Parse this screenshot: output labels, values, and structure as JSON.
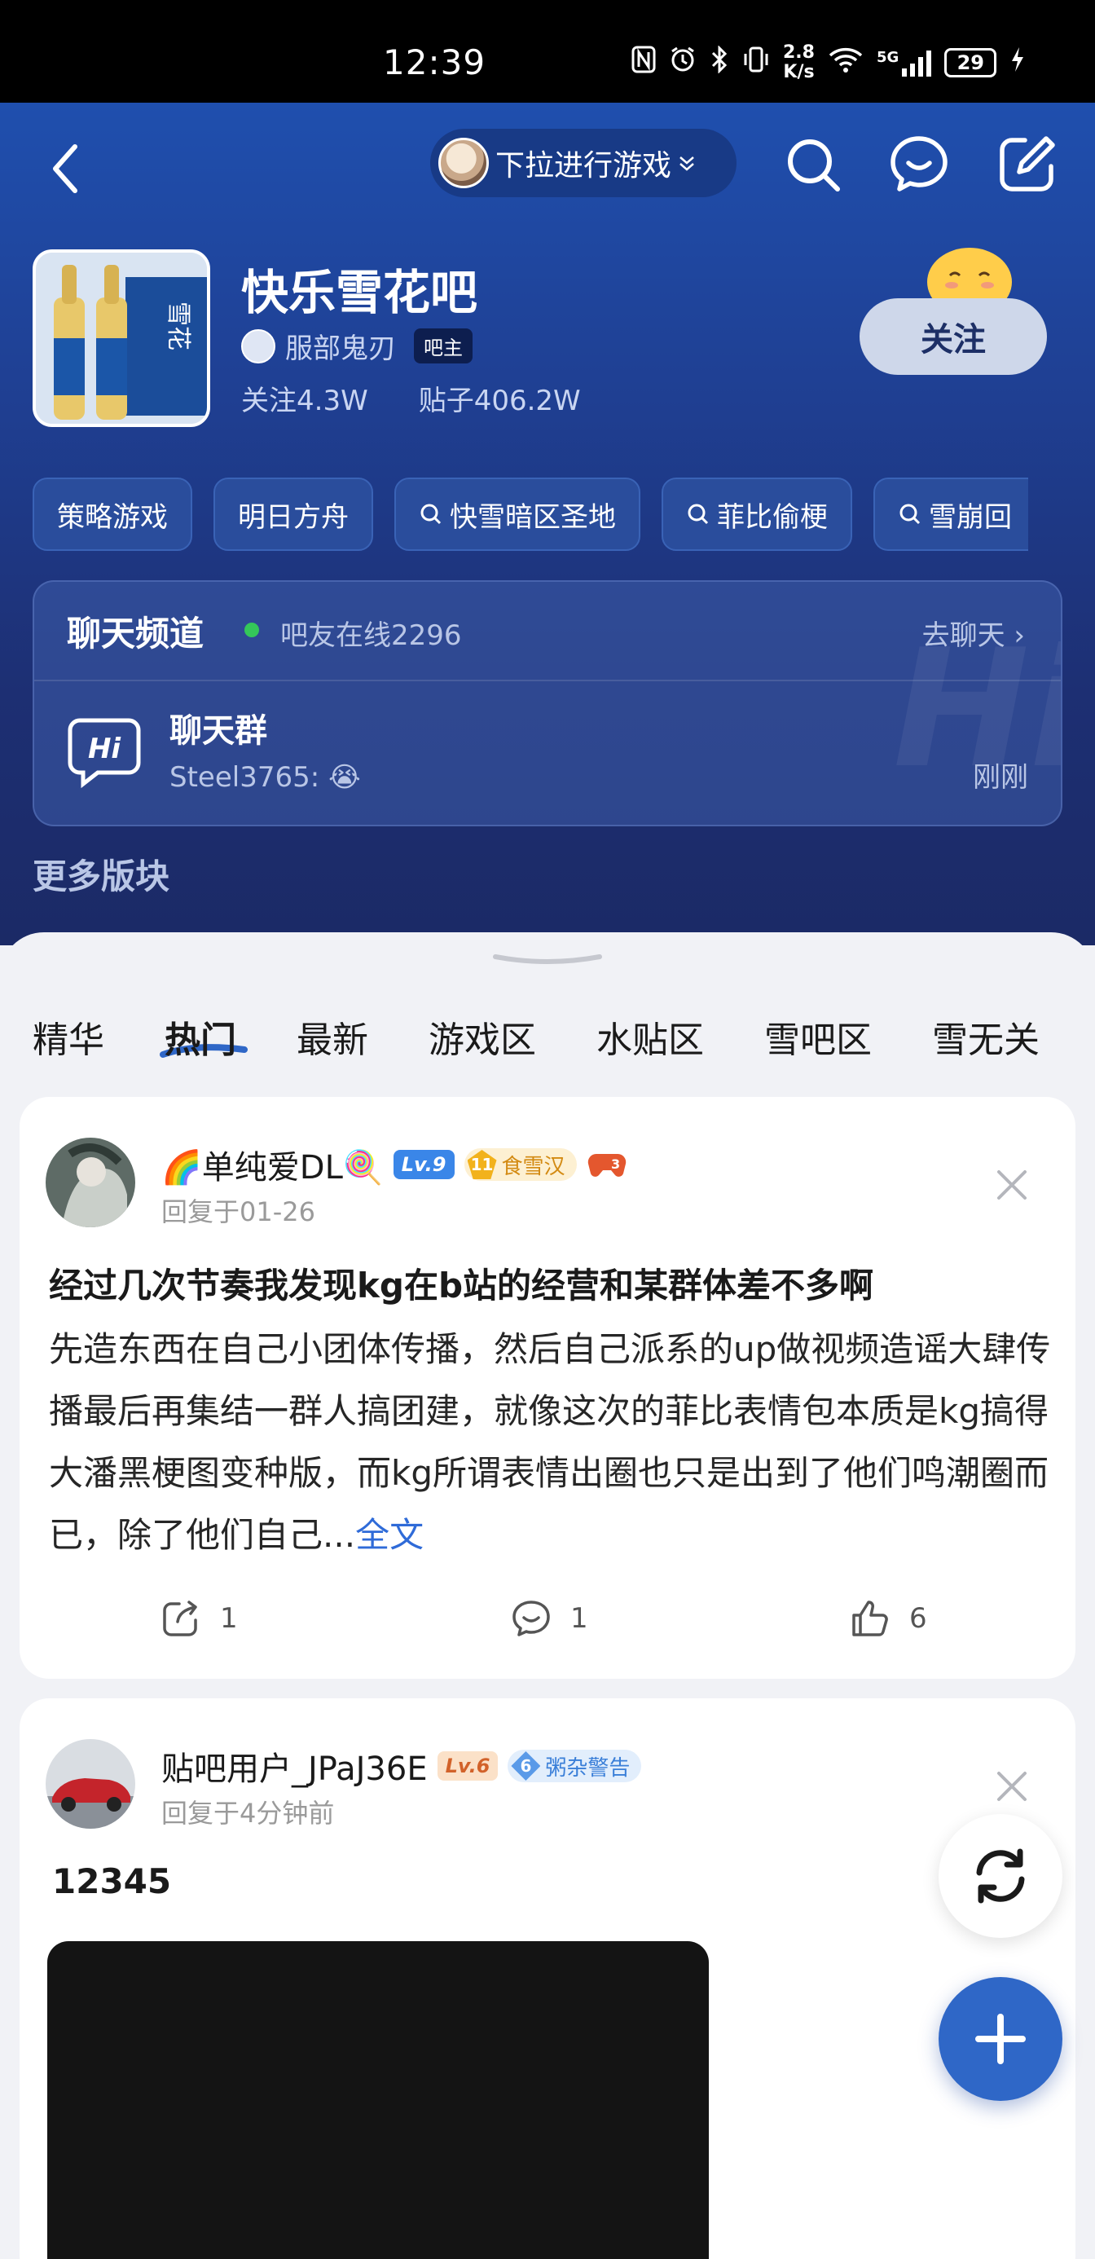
{
  "status_bar": {
    "time": "12:39",
    "net_speed_value": "2.8",
    "net_speed_unit": "K/s",
    "battery": "29",
    "network": "5G"
  },
  "header": {
    "game_pill_label": "下拉进行游戏",
    "forum_name": "快乐雪花吧",
    "owner_name": "服部鬼刃",
    "owner_badge": "吧主",
    "followers": "关注4.3W",
    "posts": "贴子406.2W",
    "follow_label": "关注",
    "tags": [
      "策略游戏",
      "明日方舟",
      "快雪暗区圣地",
      "菲比偷梗",
      "雪崩回"
    ]
  },
  "chat": {
    "title": "聊天频道",
    "online": "吧友在线2296",
    "goto": "去聊天 ›",
    "group_name": "聊天群",
    "last_message": "Steel3765: 😭",
    "time": "刚刚"
  },
  "more_sections": "更多版块",
  "feed_tabs": [
    "精华",
    "热门",
    "最新",
    "游戏区",
    "水贴区",
    "雪吧区",
    "雪无关"
  ],
  "posts": [
    {
      "username": "🌈单纯爱DL🍭",
      "level": "Lv.9",
      "honor_num": "11",
      "honor_name": "食雪汉",
      "reply_time": "回复于01-26",
      "title": "经过几次节奏我发现kg在b站的经营和某群体差不多啊",
      "body": "先造东西在自己小团体传播，然后自己派系的up做视频造谣大肆传播最后再集结一群人搞团建，就像这次的菲比表情包本质是kg搞得大潘黑梗图变种版，而kg所谓表情出圈也只是出到了他们鸣潮圈而已，除了他们自己...",
      "more": "全文",
      "shares": "1",
      "comments": "1",
      "likes": "6"
    },
    {
      "username": "贴吧用户_JPaJ36E",
      "level": "Lv.6",
      "honor_num": "6",
      "honor_name": "粥杂警告",
      "reply_time": "回复于4分钟前",
      "text": "12345"
    }
  ],
  "colors": {
    "header_top": "#1f4fae",
    "header_bottom": "#1b2a66",
    "accent_blue": "#2f67c7",
    "link_blue": "#2f6bd8"
  }
}
